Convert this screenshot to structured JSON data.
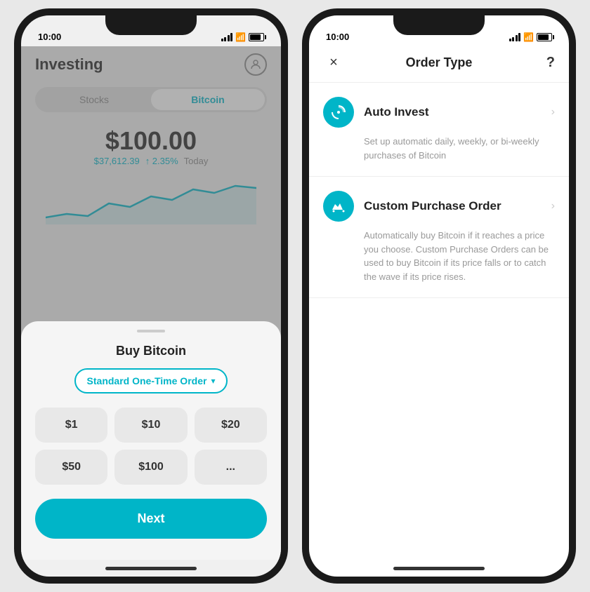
{
  "left_phone": {
    "status_time": "10:00",
    "title": "Investing",
    "tabs": [
      "Stocks",
      "Bitcoin"
    ],
    "active_tab": "Bitcoin",
    "price": "$100.00",
    "btc_price": "$37,612.39",
    "change": "↑ 2.35%",
    "date": "Today",
    "sheet": {
      "handle": true,
      "title": "Buy Bitcoin",
      "order_type": "Standard One-Time Order",
      "amounts": [
        "$1",
        "$10",
        "$20",
        "$50",
        "$100",
        "..."
      ],
      "next_label": "Next"
    }
  },
  "right_phone": {
    "status_time": "10:00",
    "header": {
      "close": "×",
      "title": "Order Type",
      "help": "?"
    },
    "options": [
      {
        "name": "Auto Invest",
        "icon": "auto-invest",
        "desc": "Set up automatic daily, weekly, or bi-weekly purchases of Bitcoin"
      },
      {
        "name": "Custom Purchase Order",
        "icon": "custom-order",
        "desc": "Automatically buy Bitcoin if it reaches a price you choose. Custom Purchase Orders can be used to buy Bitcoin if its price falls or to catch the wave if its price rises."
      }
    ]
  }
}
